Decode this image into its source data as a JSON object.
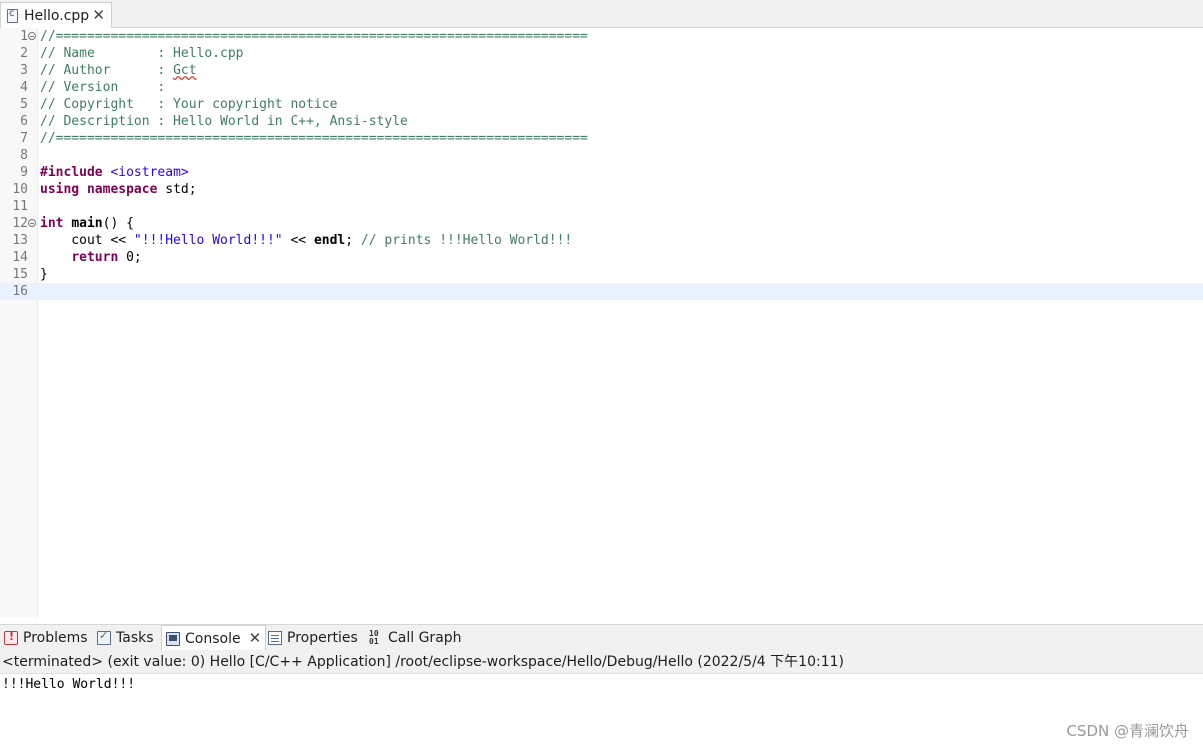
{
  "editor_tab": {
    "label": "Hello.cpp"
  },
  "code_lines": [
    {
      "num": "1",
      "text": "//===================================================================="
    },
    {
      "num": "2",
      "text": "// Name        : Hello.cpp"
    },
    {
      "num": "3",
      "prefix": "// Author      : ",
      "author": "Gct"
    },
    {
      "num": "4",
      "text": "// Version     :"
    },
    {
      "num": "5",
      "text": "// Copyright   : Your copyright notice"
    },
    {
      "num": "6",
      "text": "// Description : Hello World in C++, Ansi-style"
    },
    {
      "num": "7",
      "text": "//===================================================================="
    },
    {
      "num": "8",
      "text": ""
    },
    {
      "num": "9",
      "kw": "#include",
      "rest": " <iostream>"
    },
    {
      "num": "10",
      "kw1": "using",
      "kw2": "namespace",
      "rest": " std;"
    },
    {
      "num": "11",
      "text": ""
    },
    {
      "num": "12",
      "kw": "int",
      "fn": "main",
      "rest": "() {"
    },
    {
      "num": "13",
      "pre": "    cout << ",
      "str": "\"!!!Hello World!!!\"",
      "mid": " << ",
      "endl": "endl",
      "semi": "; ",
      "comment": "// prints !!!Hello World!!!"
    },
    {
      "num": "14",
      "kw": "return",
      "rest": " 0;"
    },
    {
      "num": "15",
      "text": "}"
    },
    {
      "num": "16",
      "text": ""
    }
  ],
  "view_tabs": {
    "problems": "Problems",
    "tasks": "Tasks",
    "console": "Console",
    "properties": "Properties",
    "call_graph": "Call Graph"
  },
  "console": {
    "status": "<terminated> (exit value: 0) Hello [C/C++ Application] /root/eclipse-workspace/Hello/Debug/Hello (2022/5/4 下午10:11)",
    "output": "!!!Hello World!!!"
  },
  "watermark": "CSDN @青澜饮舟",
  "icons": {
    "file": "cpp-file-icon",
    "close": "close-icon",
    "problems": "problems-icon",
    "tasks": "tasks-icon",
    "console": "console-icon",
    "properties": "properties-icon",
    "call_graph": "call-graph-icon",
    "fold": "fold-collapse-icon"
  }
}
